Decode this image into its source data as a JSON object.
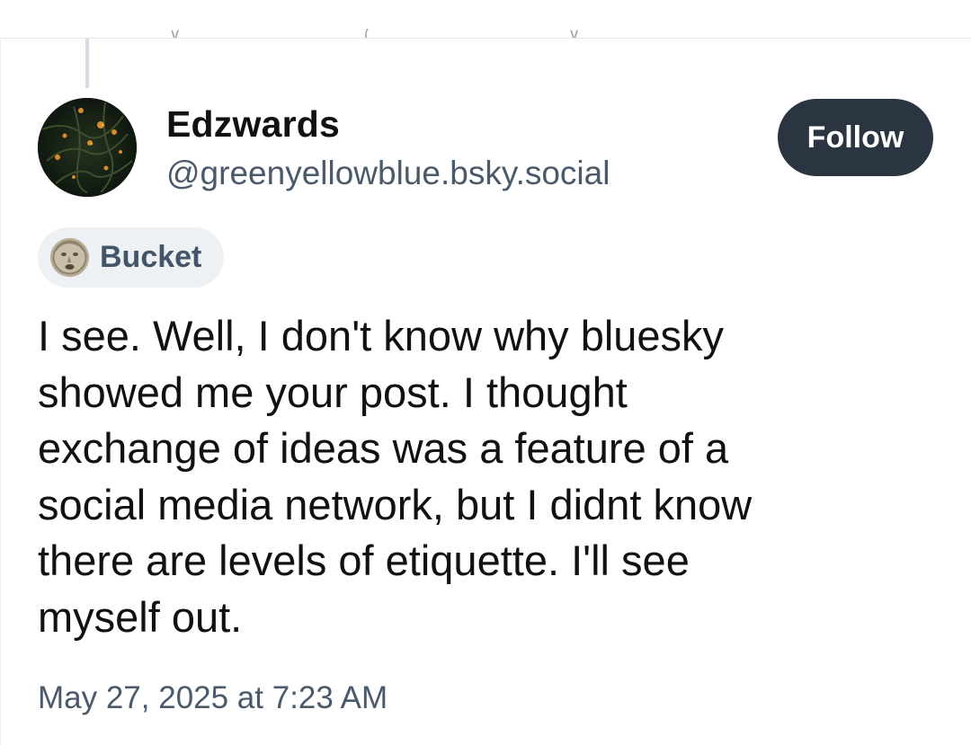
{
  "post": {
    "author": {
      "display_name": "Edzwards",
      "handle": "@greenyellowblue.bsky.social"
    },
    "follow_label": "Follow",
    "label_chip": {
      "text": "Bucket"
    },
    "body": "I see. Well, I don't know why bluesky\nshowed me your post. I thought\nexchange of ideas was a feature of a\nsocial media network, but I didnt know\nthere are levels of etiquette. I'll see\nmyself out.",
    "timestamp": "May 27, 2025 at 7:23 AM"
  },
  "colors": {
    "follow_button_bg": "#2a3541",
    "handle_text": "#4a5a6b",
    "chip_bg": "#eef1f4",
    "thread_line": "#d4dbe2"
  },
  "icons": {
    "cutoff_action_icons": [
      "reply-icon",
      "repost-icon",
      "like-icon"
    ]
  }
}
